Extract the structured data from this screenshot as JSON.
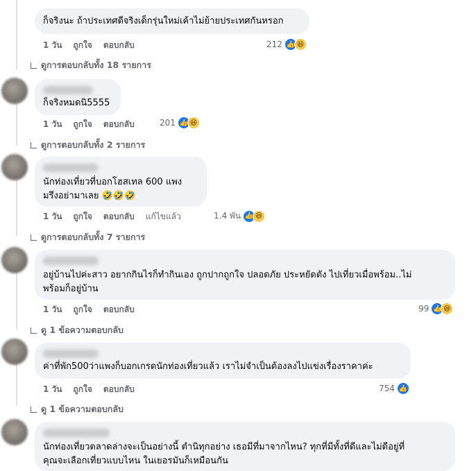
{
  "comments": [
    {
      "lines": [
        "ก็จริงนะ ถ้าประเทศดีจริงเด็กรุ่นใหม่เค้าไม่ย้ายประเทศกันหรอก"
      ],
      "time": "1 วัน",
      "like_label": "ถูกใจ",
      "reply_label": "ตอบกลับ",
      "edited": "",
      "reaction_count": "212",
      "view_replies": "ดูการตอบกลับทั้ง 18 รายการ"
    },
    {
      "lines": [
        "ก็จริงหมดนิ5555"
      ],
      "time": "1 วัน",
      "like_label": "ถูกใจ",
      "reply_label": "ตอบกลับ",
      "edited": "",
      "reaction_count": "201",
      "view_replies": "ดูการตอบกลับทั้ง 2 รายการ"
    },
    {
      "lines": [
        "นักท่องเที่ยวที่บอกโฮสเทล 600 แพง",
        "มรึงอย่ามาเลย 🤣🤣🤣"
      ],
      "time": "1 วัน",
      "like_label": "ถูกใจ",
      "reply_label": "ตอบกลับ",
      "edited": "แก้ไขแล้ว",
      "reaction_count": "1.4 พัน",
      "view_replies": "ดูการตอบกลับทั้ง 7 รายการ"
    },
    {
      "lines": [
        "อยู่บ้านไปค่ะสาว อยากกินไรก็ทำกินเอง ถูกปากถูกใจ ปลอดภัย ประหยัดตัง ไปเที่ยวเมื่อพร้อม..ไม่",
        "พร้อมก็อยู่บ้าน"
      ],
      "time": "1 วัน",
      "like_label": "ถูกใจ",
      "reply_label": "ตอบกลับ",
      "edited": "",
      "reaction_count": "99",
      "view_replies": "ดู 1 ข้อความตอบกลับ"
    },
    {
      "lines": [
        "ค่าที่พัก500ว่าแพงก็บอกเกรดนักท่องเที่ยวแล้ว เราไม่จำเป็นต้องลงไปแข่งเรื่องราคาค่ะ"
      ],
      "time": "1 วัน",
      "like_label": "ถูกใจ",
      "reply_label": "ตอบกลับ",
      "edited": "",
      "reaction_count": "754",
      "view_replies": "ดู 1 ข้อความตอบกลับ"
    },
    {
      "lines": [
        "นักท่องเที่ยวตลาดล่างจะเป็นอย่างนี้ ตำนิทุกอย่าง เธอมีที่มาจากไหน? ทุกที่มีทั้งที่ดีและไม่ดีอยู่ที่",
        "คุณจะเลือกเที่ยวแบบไหน ในเยอรมันก็เหมือนกัน"
      ]
    }
  ],
  "colors": {
    "bubble": "#f0f2f5",
    "like": "#1877f2",
    "meta": "#65676b"
  }
}
